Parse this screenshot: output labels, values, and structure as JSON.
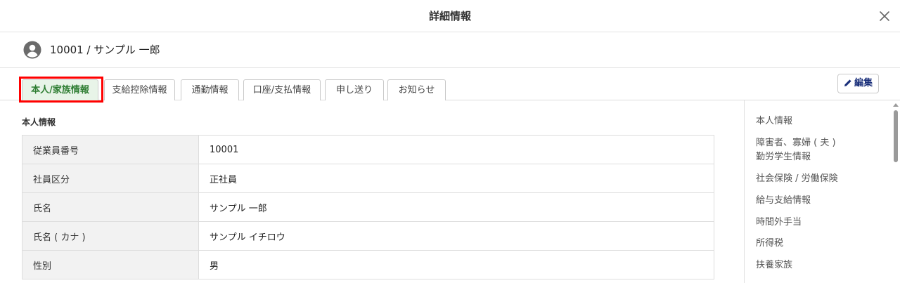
{
  "dialog": {
    "title": "詳細情報",
    "close_icon": "close-icon"
  },
  "employee": {
    "avatar_icon": "account-circle-icon",
    "display": "10001 / サンプル 一郎"
  },
  "tabs": [
    {
      "label": "本人/家族情報",
      "active": true
    },
    {
      "label": "支給控除情報",
      "active": false
    },
    {
      "label": "通勤情報",
      "active": false
    },
    {
      "label": "口座/支払情報",
      "active": false
    },
    {
      "label": "申し送り",
      "active": false
    },
    {
      "label": "お知らせ",
      "active": false
    }
  ],
  "edit_button": {
    "icon": "pencil-icon",
    "label": "編集"
  },
  "section": {
    "title": "本人情報"
  },
  "info_rows": [
    {
      "label": "従業員番号",
      "value": "10001"
    },
    {
      "label": "社員区分",
      "value": "正社員"
    },
    {
      "label": "氏名",
      "value": "サンプル 一郎"
    },
    {
      "label": "氏名 ( カナ )",
      "value": "サンプル イチロウ"
    },
    {
      "label": "性別",
      "value": "男"
    }
  ],
  "side_nav": [
    {
      "label": "本人情報"
    },
    {
      "label": "障害者、寡婦 ( 夫 )\n勤労学生情報",
      "line1": "障害者、寡婦 ( 夫 )",
      "line2": "勤労学生情報"
    },
    {
      "label": "社会保険 / 労働保険"
    },
    {
      "label": "給与支給情報"
    },
    {
      "label": "時間外手当"
    },
    {
      "label": "所得税"
    },
    {
      "label": "扶養家族"
    }
  ],
  "colors": {
    "active_tab_bg": "#e8f4e8",
    "active_tab_text": "#2e7d32",
    "highlight_border": "#ff0000",
    "edit_button_text": "#1a2f7a",
    "label_cell_bg": "#f2f2f2"
  }
}
